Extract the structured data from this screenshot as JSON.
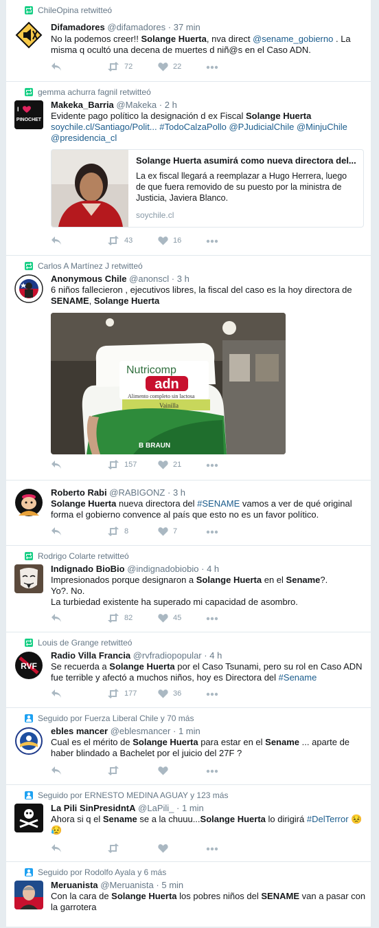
{
  "tweets": [
    {
      "context": "ChileOpina retwitteó",
      "name": "Difamadores",
      "handle": "@difamadores",
      "time": "37 min",
      "text_parts": [
        "No la podemos creer!! ",
        "Solange Huerta",
        ", nva direct ",
        "@sename_gobierno",
        " . La misma q ocultó una decena de muertes d niñ@s en el Caso ADN."
      ],
      "retweets": "72",
      "likes": "22"
    },
    {
      "context": "gemma achurra fagnil retwitteó",
      "name": "Makeka_Barria",
      "handle": "@Makeka",
      "time": "2 h",
      "line1_a": "Evidente pago político la designación d ex Fiscal ",
      "line1_b": "Solange Huerta",
      "line2": "soychile.cl/Santiago/Polit...",
      "line2_tags": [
        "#TodoCalzaPollo",
        "@PJudicialChile",
        "@MinjuChile"
      ],
      "line3": "@presidencia_cl",
      "avatar_text": "PINOCHET",
      "card_title": "Solange Huerta asumirá como nueva directora del...",
      "card_desc": "La ex fiscal llegará a reemplazar a Hugo Herrera, luego de que fuera removido de su puesto por la ministra de Justicia, Javiera Blanco.",
      "card_domain": "soychile.cl",
      "retweets": "43",
      "likes": "16"
    },
    {
      "context": "Carlos A Martínez J retwitteó",
      "name": "Anonymous Chile",
      "handle": "@anonscl",
      "time": "3 h",
      "line1": "6 niños fallecieron , ejecutivos libres, la fiscal del caso es la hoy directora de",
      "line2_a": "SENAME",
      "line2_b": ", ",
      "line2_c": "Solange Huerta",
      "media_brand": "Nutricomp",
      "media_logo": "adn",
      "media_sub": "Alimento completo sin lactosa",
      "media_flavor": "Vainilla",
      "media_maker": "B BRAUN",
      "retweets": "157",
      "likes": "21"
    },
    {
      "name": "Roberto Rabi",
      "handle": "@RABIGONZ",
      "time": "3 h",
      "line1_a": "Solange Huerta",
      "line1_b": " nueva directora del ",
      "line1_c": "#SENAME",
      "line1_d": " vamos a ver de qué original",
      "line2": "forma el gobierno convence al país que esto no es un favor político.",
      "retweets": "8",
      "likes": "7"
    },
    {
      "context": "Rodrigo Colarte retwitteó",
      "name": "Indignado BioBio",
      "handle": "@indignadobiobio",
      "time": "4 h",
      "line1_a": "Impresionados porque designaron a ",
      "line1_b": "Solange Huerta",
      "line1_c": " en el ",
      "line1_d": "Sename",
      "line1_e": "?.",
      "line2": "Yo?. No.",
      "line3": "La turbiedad existente ha superado mi capacidad de asombro.",
      "retweets": "82",
      "likes": "45"
    },
    {
      "context": "Louis de Grange retwitteó",
      "name": "Radio Villa Francia",
      "handle": "@rvfradiopopular",
      "time": "4 h",
      "avatar_text": "RVF",
      "line1_a": "Se recuerda a ",
      "line1_b": "Solange Huerta",
      "line1_c": " por el Caso Tsunami, pero su rol en Caso ADN",
      "line2_a": "fue terrible y afectó a muchos niños, hoy es Directora del ",
      "line2_b": "#Sename",
      "retweets": "177",
      "likes": "36"
    },
    {
      "context": "Seguido por Fuerza Liberal Chile y 70 más",
      "name": "ebles mancer",
      "handle": "@eblesmancer",
      "time": "1 min",
      "line1_a": "Cual es el mérito de ",
      "line1_b": "Solange Huerta",
      "line1_c": " para estar en el ",
      "line1_d": "Sename",
      "line1_e": " ... aparte de",
      "line2": "haber blindado a Bachelet por el juicio del 27F ?",
      "retweets": "",
      "likes": ""
    },
    {
      "context": "Seguido por ERNESTO MEDINA AGUAY y 123 más",
      "name": "La Pili SinPresidntA",
      "handle": "@LaPili_",
      "time": "1 min",
      "line1_a": "Ahora si q el ",
      "line1_b": "Sename",
      "line1_c": " se a la chuuu...",
      "line1_d": "Solange Huerta",
      "line1_e": " lo dirigirá ",
      "line1_f": "#DelTerror",
      "emoji1": "😣",
      "emoji2": "😥",
      "retweets": "",
      "likes": ""
    },
    {
      "context": "Seguido por Rodolfo Ayala y 6 más",
      "name": "Meruanista",
      "handle": "@Meruanista",
      "time": "5 min",
      "line1_a": "Con la cara de ",
      "line1_b": "Solange Huerta",
      "line1_c": " los pobres niños del ",
      "line1_d": "SENAME",
      "line1_e": " van a pasar con",
      "line2": "la garrotera"
    }
  ],
  "colors": {
    "link": "#1b5c8c",
    "retweet_context": "#19cf86",
    "follow_context": "#1da1f2",
    "action_gray": "#aab8c2"
  }
}
